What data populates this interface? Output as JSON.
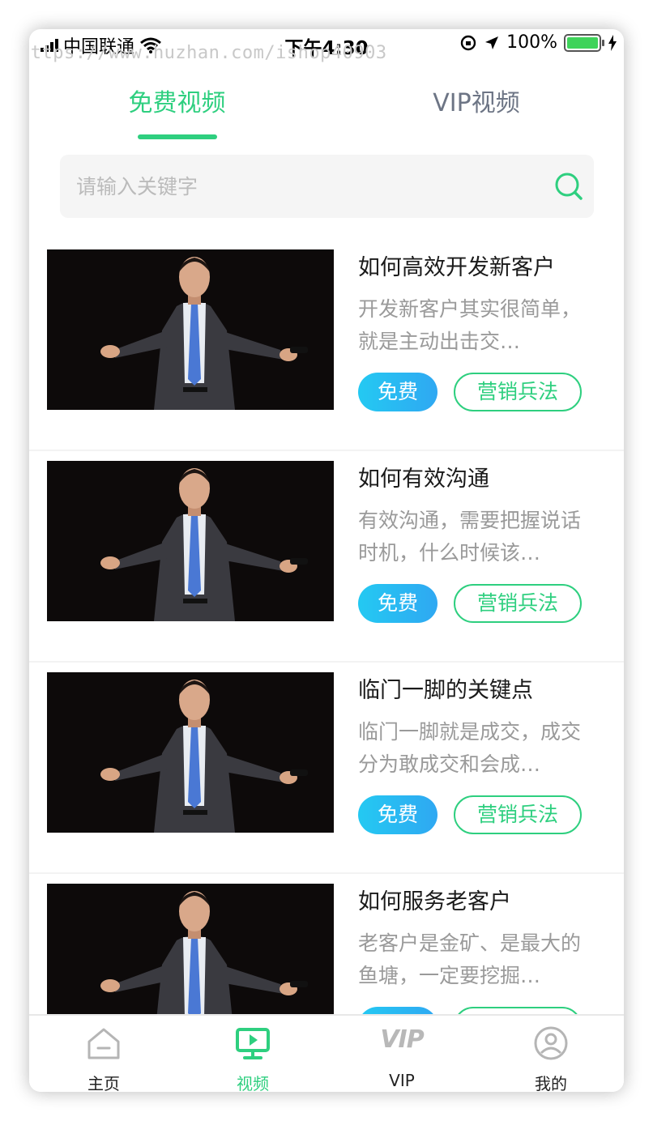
{
  "status_bar": {
    "carrier": "中国联通",
    "time": "下午4:30",
    "battery": "100%",
    "watermark": "https://www.huzhan.com/ishop40903"
  },
  "tabs": [
    {
      "label": "免费视频",
      "active": true
    },
    {
      "label": "VIP视频",
      "active": false
    }
  ],
  "search": {
    "placeholder": "请输入关键字"
  },
  "videos": [
    {
      "title": "如何高效开发新客户",
      "desc": "开发新客户其实很简单，就是主动出击交…",
      "badge": "免费",
      "category": "营销兵法"
    },
    {
      "title": "如何有效沟通",
      "desc": "有效沟通，需要把握说话时机，什么时候该…",
      "badge": "免费",
      "category": "营销兵法"
    },
    {
      "title": "临门一脚的关键点",
      "desc": "临门一脚就是成交，成交分为敢成交和会成…",
      "badge": "免费",
      "category": "营销兵法"
    },
    {
      "title": "如何服务老客户",
      "desc": "老客户是金矿、是最大的鱼塘，一定要挖掘…",
      "badge": "免费",
      "category": "营销兵法"
    }
  ],
  "bottom_nav": [
    {
      "label": "主页",
      "icon": "home-icon",
      "active": false
    },
    {
      "label": "视频",
      "icon": "video-icon",
      "active": true
    },
    {
      "label": "VIP",
      "icon": "vip-icon",
      "active": false
    },
    {
      "label": "我的",
      "icon": "profile-icon",
      "active": false
    }
  ],
  "colors": {
    "accent": "#2ecf7f",
    "badge_blue": "#24c9f2",
    "inactive_tab": "#6d7585",
    "desc_gray": "#9a9a9a"
  }
}
